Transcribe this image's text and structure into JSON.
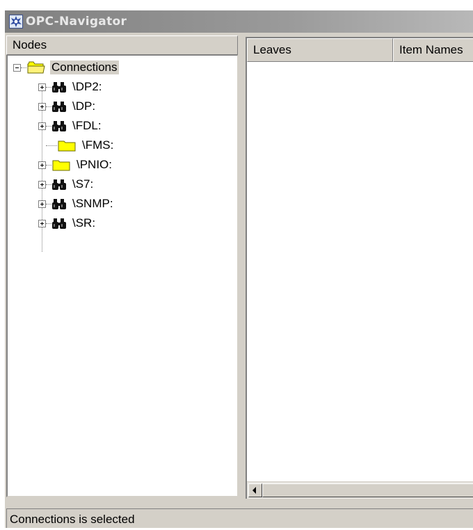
{
  "window": {
    "title": "OPC-Navigator",
    "icon": "opc-navigator-app-icon"
  },
  "tree": {
    "header": "Nodes",
    "root": {
      "label": "Connections",
      "expanded": true,
      "selected": true,
      "icon": "open-folder-icon"
    },
    "children": [
      {
        "label": "\\DP2:",
        "icon": "binoculars-icon",
        "expandable": true
      },
      {
        "label": "\\DP:",
        "icon": "binoculars-icon",
        "expandable": true
      },
      {
        "label": "\\FDL:",
        "icon": "binoculars-icon",
        "expandable": true
      },
      {
        "label": "\\FMS:",
        "icon": "folder-icon",
        "expandable": false
      },
      {
        "label": "\\PNIO:",
        "icon": "folder-icon",
        "expandable": true
      },
      {
        "label": "\\S7:",
        "icon": "binoculars-icon",
        "expandable": true
      },
      {
        "label": "\\SNMP:",
        "icon": "binoculars-icon",
        "expandable": true
      },
      {
        "label": "\\SR:",
        "icon": "binoculars-icon",
        "expandable": true
      }
    ]
  },
  "list": {
    "columns": [
      "Leaves",
      "Item Names"
    ]
  },
  "status": {
    "text": "Connections is selected"
  },
  "colors": {
    "face": "#d4d0c8",
    "folder": "#ffff00",
    "titlebar": "#808080"
  }
}
